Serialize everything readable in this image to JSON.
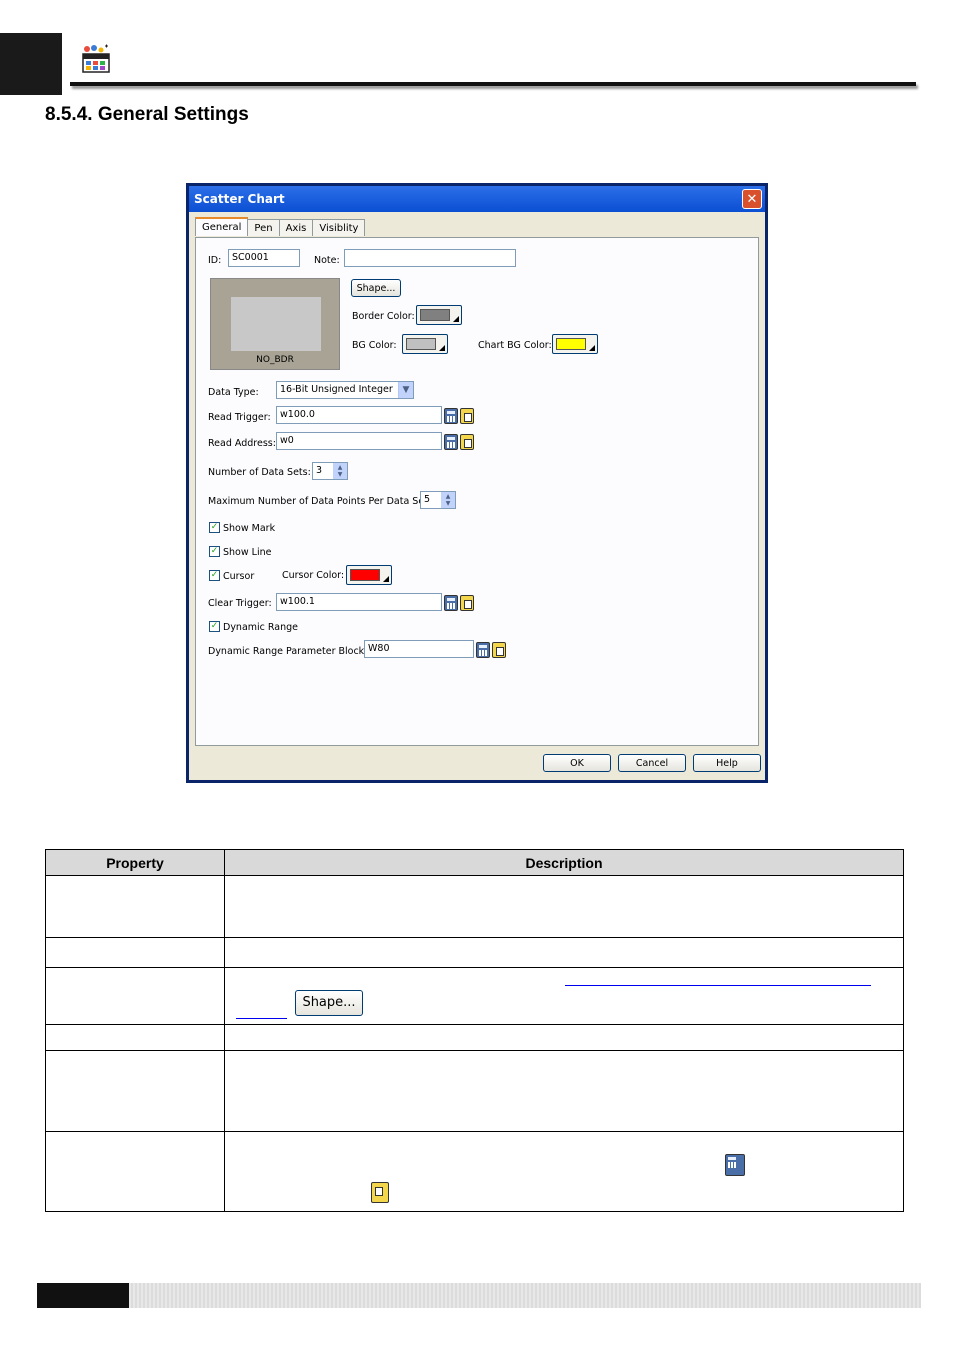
{
  "header": {
    "section_title": "8.5.4. General Settings"
  },
  "dialog": {
    "title": "Scatter Chart",
    "close_label": "✕",
    "tabs": [
      {
        "label": "General"
      },
      {
        "label": "Pen"
      },
      {
        "label": "Axis"
      },
      {
        "label": "Visiblity"
      }
    ],
    "general": {
      "id_label": "ID:",
      "id_value": "SC0001",
      "note_label": "Note:",
      "note_value": "",
      "shape_button": "Shape...",
      "preview_caption": "NO_BDR",
      "border_color_label": "Border Color:",
      "border_color": "#808080",
      "bg_color_label": "BG Color:",
      "bg_color": "#c0c0c0",
      "chart_bg_color_label": "Chart BG Color:",
      "chart_bg_color": "#ffff00",
      "data_type_label": "Data Type:",
      "data_type_value": "16-Bit Unsigned Integer",
      "read_trigger_label": "Read Trigger:",
      "read_trigger_value": "w100.0",
      "read_address_label": "Read Address:",
      "read_address_value": "w0",
      "num_data_sets_label": "Number of Data Sets:",
      "num_data_sets_value": "3",
      "max_points_label": "Maximum Number of Data Points Per Data Set:",
      "max_points_value": "5",
      "show_mark_label": "Show Mark",
      "show_line_label": "Show Line",
      "cursor_label": "Cursor",
      "cursor_color_label": "Cursor Color:",
      "cursor_color": "#ff0000",
      "clear_trigger_label": "Clear Trigger:",
      "clear_trigger_value": "w100.1",
      "dynamic_range_label": "Dynamic Range",
      "dynamic_range_block_label": "Dynamic Range Parameter Block:",
      "dynamic_range_block_value": "W80",
      "check_mark": "✓"
    },
    "buttons": {
      "ok": "OK",
      "cancel": "Cancel",
      "help": "Help"
    }
  },
  "table": {
    "headers": [
      "Property",
      "Description"
    ],
    "shape_button": "Shape..."
  }
}
